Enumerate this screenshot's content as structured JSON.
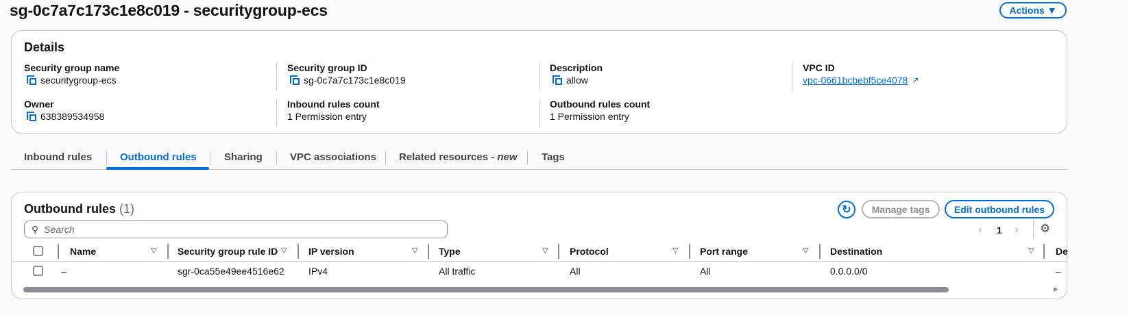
{
  "header": {
    "title": "sg-0c7a7c173c1e8c019 - securitygroup-ecs",
    "actions_label": "Actions ▼"
  },
  "details": {
    "title": "Details",
    "fields": [
      {
        "label": "Security group name",
        "value": "securitygroup-ecs"
      },
      {
        "label": "Security group ID",
        "value": "sg-0c7a7c173c1e8c019"
      },
      {
        "label": "Description",
        "value": "allow"
      },
      {
        "label": "VPC ID",
        "value": "vpc-0661bcbebf5ce4078"
      },
      {
        "label": "Owner",
        "value": "638389534958"
      },
      {
        "label": "Inbound rules count",
        "value": "1 Permission entry"
      },
      {
        "label": "Outbound rules count",
        "value": "1 Permission entry"
      }
    ]
  },
  "tabs": [
    "Inbound rules",
    "Outbound rules",
    "Sharing",
    "VPC associations",
    "Related resources - ",
    "new",
    "Tags"
  ],
  "rules": {
    "title": "Outbound rules",
    "count": "(1)",
    "manage_tags": "Manage tags",
    "edit": "Edit outbound rules",
    "search_placeholder": "Search",
    "page": "1",
    "columns": [
      "Name",
      "Security group rule ID",
      "IP version",
      "Type",
      "Protocol",
      "Port range",
      "Destination",
      "De"
    ],
    "rows": [
      [
        "–",
        "sgr-0ca55e49ee4516e62",
        "IPv4",
        "All traffic",
        "All",
        "All",
        "0.0.0.0/0",
        "–"
      ]
    ]
  },
  "colors": {
    "accent": "#006ce0"
  }
}
